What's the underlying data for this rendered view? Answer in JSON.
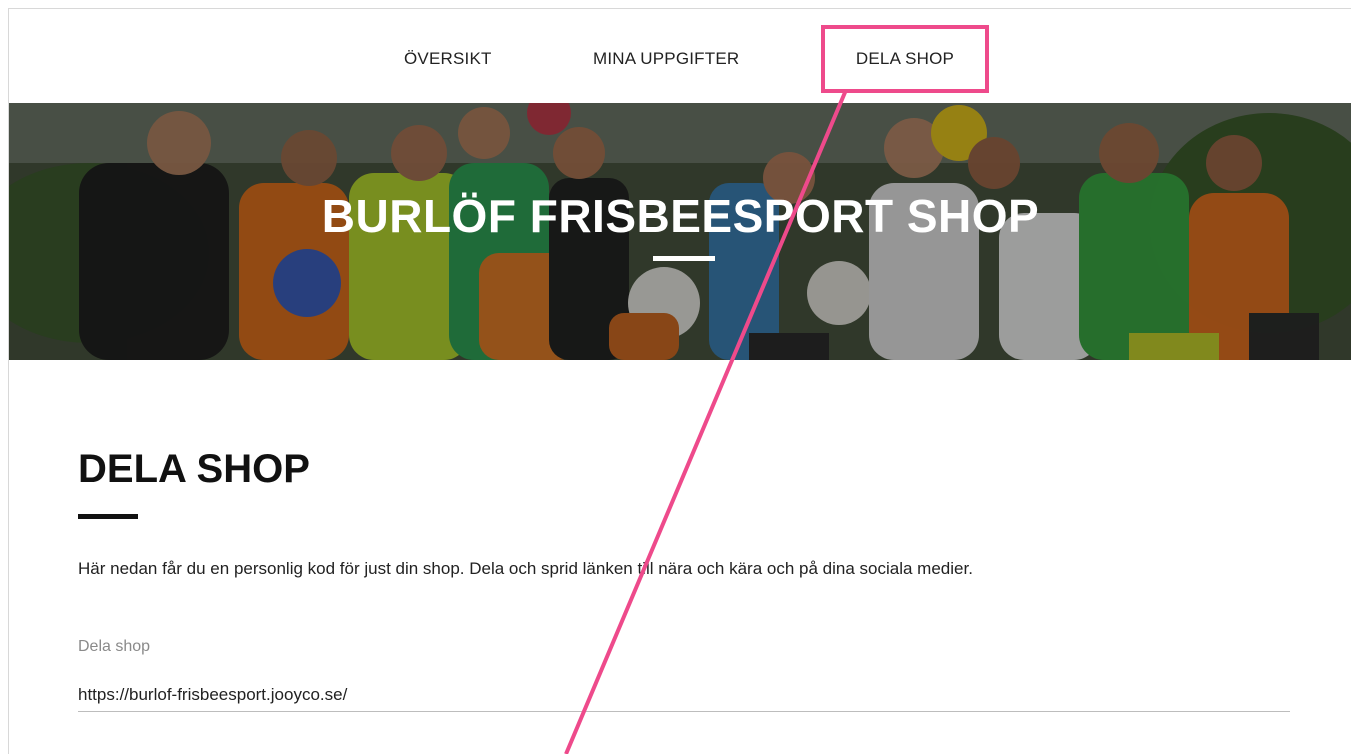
{
  "nav": {
    "items": [
      {
        "label": "ÖVERSIKT"
      },
      {
        "label": "MINA UPPGIFTER"
      },
      {
        "label": "DELA SHOP"
      }
    ]
  },
  "hero": {
    "title": "BURLÖF FRISBEESPORT SHOP"
  },
  "main": {
    "title": "DELA SHOP",
    "description": "Här nedan får du en personlig kod för just din shop. Dela och sprid länken till nära och kära och på dina sociala medier.",
    "share_field": {
      "label": "Dela shop",
      "value": "https://burlof-frisbeesport.jooyco.se/"
    }
  },
  "colors": {
    "highlight": "#ee4a8b",
    "text": "#222222"
  }
}
